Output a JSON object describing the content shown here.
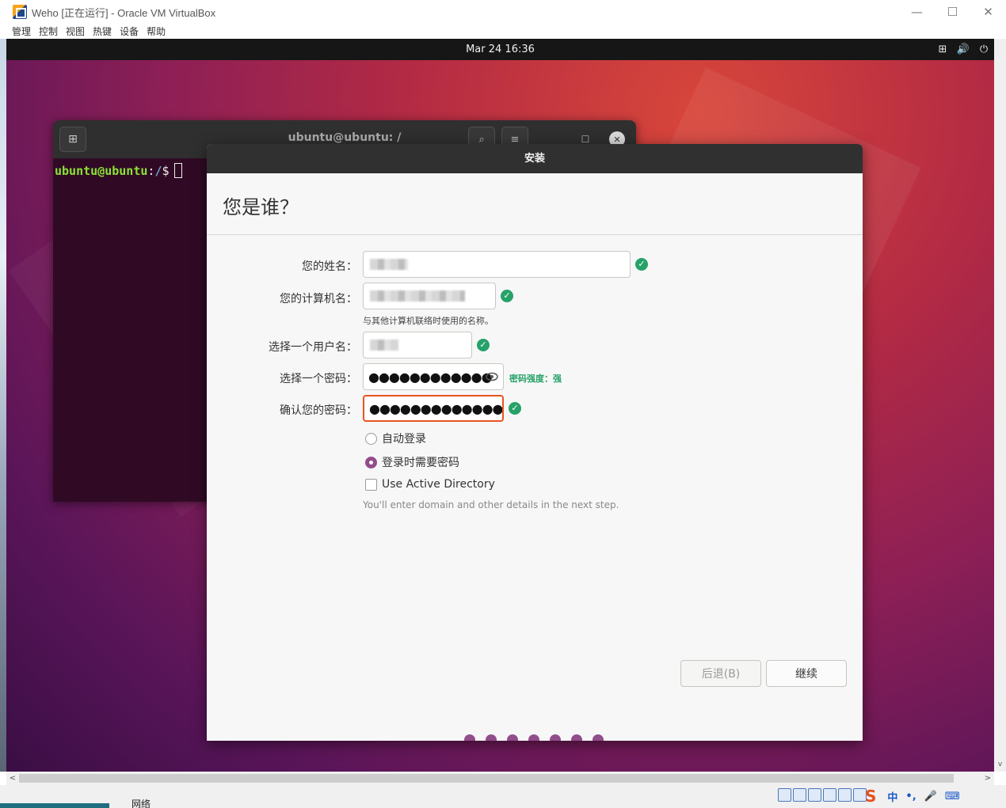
{
  "vbox": {
    "title": "Weho [正在运行] - Oracle VM VirtualBox",
    "controls": {
      "minimize": "—",
      "maximize": "☐",
      "close": "✕"
    },
    "menu": [
      "管理",
      "控制",
      "视图",
      "热键",
      "设备",
      "帮助"
    ]
  },
  "topbar": {
    "clock": "Mar 24  16:36",
    "tray": {
      "network": "⊞",
      "volume": "🔊",
      "power": "⏻"
    }
  },
  "terminal": {
    "title": "ubuntu@ubuntu: /",
    "prompt_user": "ubuntu@ubuntu",
    "prompt_colon": ":",
    "prompt_path": "/",
    "prompt_sign": "$",
    "btn_newtab": "⊞",
    "btn_search": "⌕",
    "btn_menu": "≡",
    "btn_min": "_",
    "btn_max": "☐",
    "btn_close": "✕"
  },
  "installer": {
    "title": "安装",
    "heading": "您是谁？",
    "fields": {
      "name_label": "您的姓名：",
      "computer_label": "您的计算机名：",
      "computer_hint": "与其他计算机联络时使用的名称。",
      "username_label": "选择一个用户名：",
      "password_label": "选择一个密码：",
      "password_value": "●●●●●●●●●●●●",
      "password_strength": "密码强度：强",
      "confirm_label": "确认您的密码：",
      "confirm_value": "●●●●●●●●●●●●●"
    },
    "check_glyph": "✓",
    "options": {
      "auto_login": "自动登录",
      "require_password": "登录时需要密码",
      "active_directory": "Use Active Directory",
      "ad_hint": "You'll enter domain and other details in the next step."
    },
    "buttons": {
      "back": "后退(B)",
      "continue": "继续"
    },
    "progress": {
      "total_steps": 7
    }
  },
  "statusbar": {
    "net_label": "网络",
    "ime": {
      "logo": "S",
      "lang": "中",
      "punct": "•,",
      "mic": "🎤",
      "kbd": "⌨"
    }
  },
  "scroll_arrows": {
    "left": "<",
    "right": ">",
    "down": "v"
  }
}
